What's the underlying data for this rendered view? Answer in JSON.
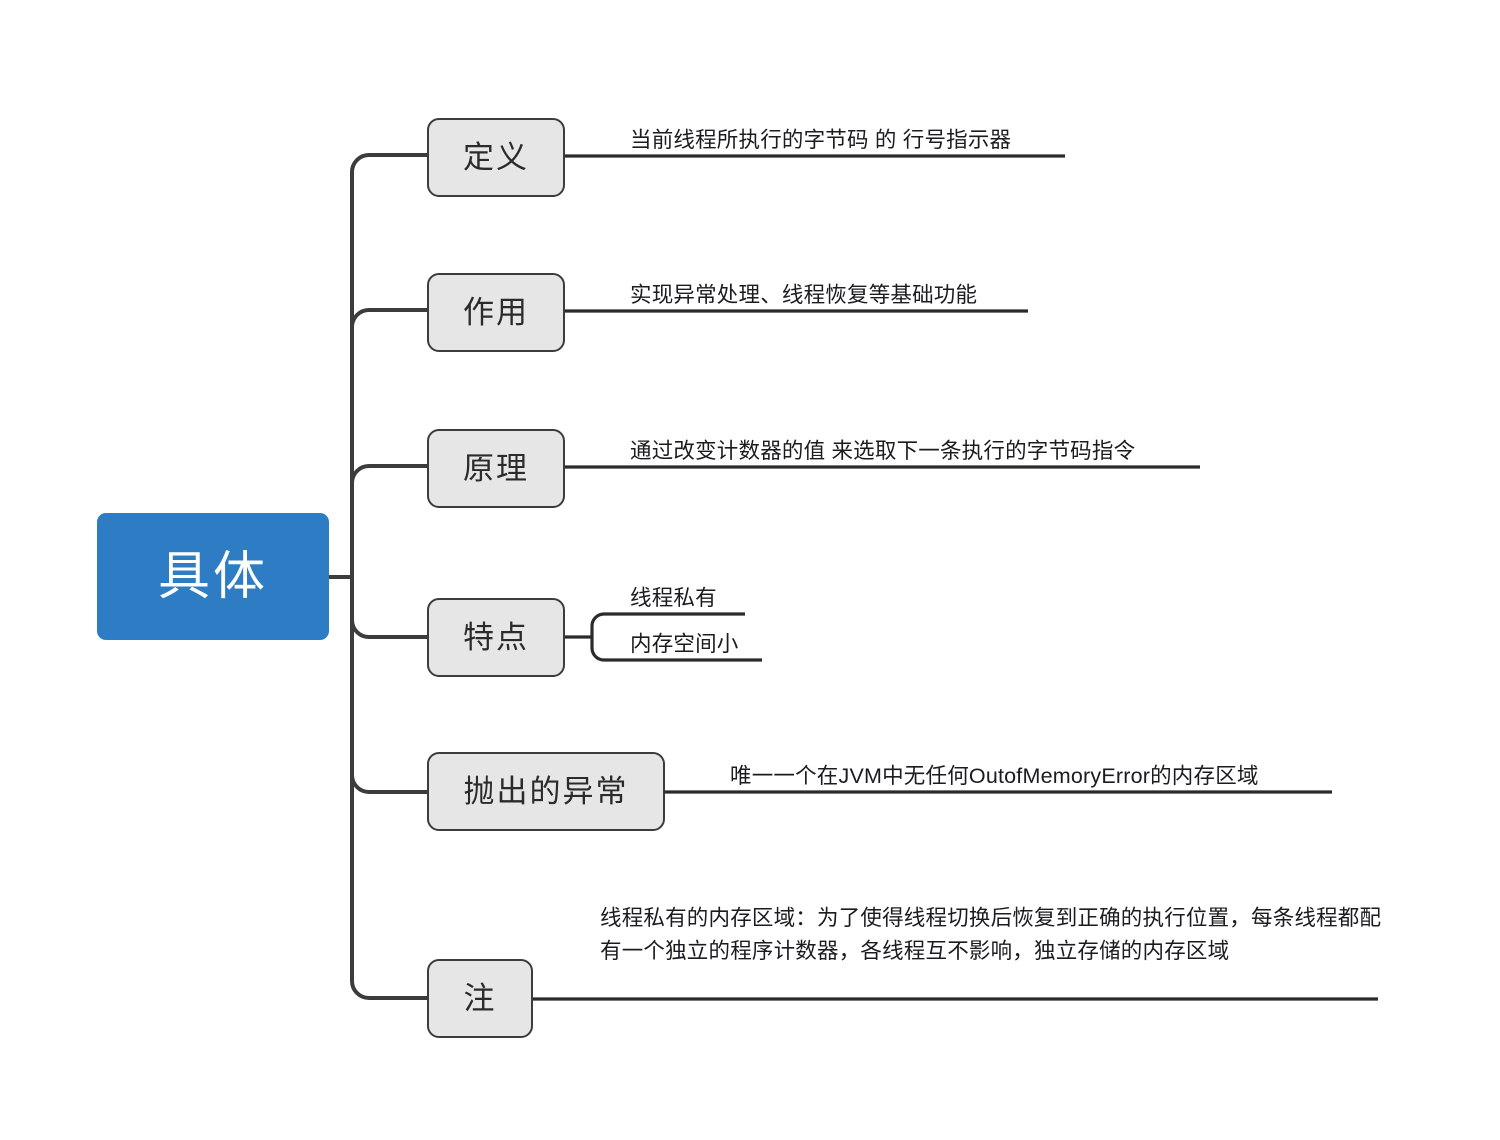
{
  "diagram": {
    "type": "mind-map",
    "title": "具体",
    "root": {
      "label": "具体",
      "color": "#2E7CC3",
      "text_color": "#ffffff"
    },
    "node_style": {
      "fill": "#E6E6E6",
      "stroke": "#3C3C3C",
      "text_color": "#2B2B2B"
    },
    "branches": [
      {
        "label": "定义",
        "leaves": [
          {
            "text": "当前线程所执行的字节码 的 行号指示器"
          }
        ]
      },
      {
        "label": "作用",
        "leaves": [
          {
            "text": "实现异常处理、线程恢复等基础功能"
          }
        ]
      },
      {
        "label": "原理",
        "leaves": [
          {
            "text": "通过改变计数器的值 来选取下一条执行的字节码指令"
          }
        ]
      },
      {
        "label": "特点",
        "leaves": [
          {
            "text": "线程私有"
          },
          {
            "text": "内存空间小"
          }
        ]
      },
      {
        "label": "抛出的异常",
        "leaves": [
          {
            "text": "唯一一个在JVM中无任何OutofMemoryError的内存区域"
          }
        ]
      },
      {
        "label": "注",
        "leaves": [
          {
            "text": "线程私有的内存区域：为了使得线程切换后恢复到正确的执行位置，每条线程都配有一个独立的程序计数器，各线程互不影响，独立存储的内存区域"
          }
        ]
      }
    ]
  }
}
